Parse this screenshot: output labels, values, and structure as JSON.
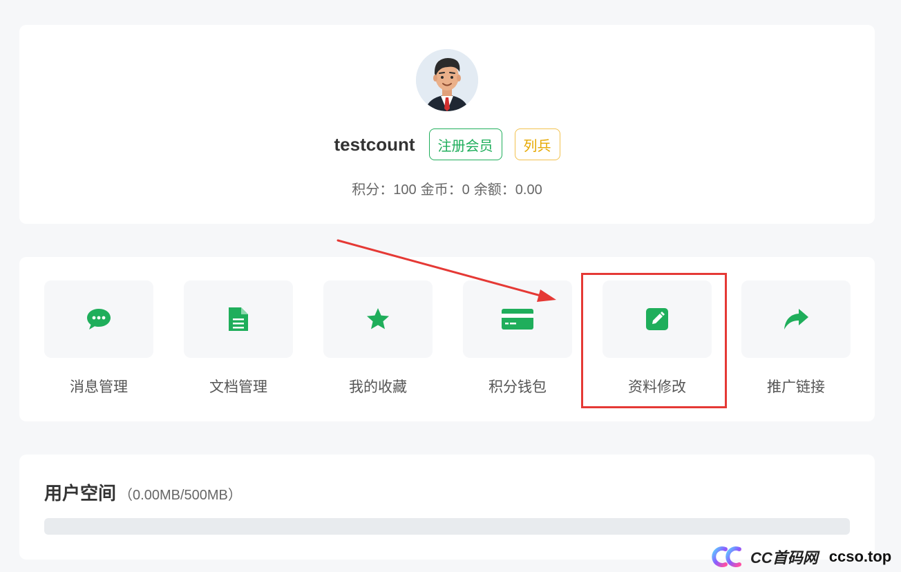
{
  "profile": {
    "username": "testcount",
    "badges": [
      "注册会员",
      "列兵"
    ],
    "stats": {
      "points_label": "积分：",
      "points_value": "100",
      "coins_label": "金币：",
      "coins_value": "0",
      "balance_label": "余额：",
      "balance_value": "0.00"
    }
  },
  "menu": {
    "items": [
      {
        "label": "消息管理",
        "icon": "chat-bubble-icon"
      },
      {
        "label": "文档管理",
        "icon": "document-icon"
      },
      {
        "label": "我的收藏",
        "icon": "star-icon"
      },
      {
        "label": "积分钱包",
        "icon": "credit-card-icon"
      },
      {
        "label": "资料修改",
        "icon": "edit-icon"
      },
      {
        "label": "推广链接",
        "icon": "share-icon"
      }
    ]
  },
  "storage": {
    "title": "用户空间",
    "usage": "（0.00MB/500MB）",
    "used_fraction": 0
  },
  "watermark": {
    "brand": "CC首码网",
    "site": "ccso.top"
  },
  "colors": {
    "accent": "#1fae5b",
    "annotation": "#e53935",
    "badge_yellow": "#e6a800"
  }
}
